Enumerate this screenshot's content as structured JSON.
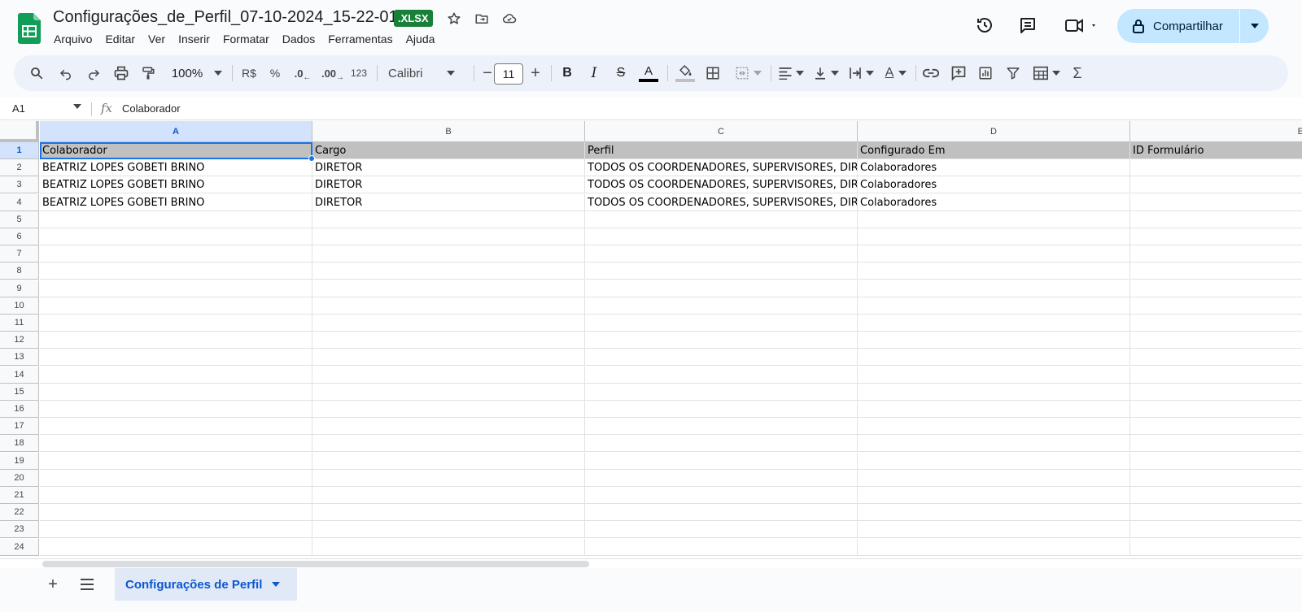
{
  "doc": {
    "title": "Configurações_de_Perfil_07-10-2024_15-22-01",
    "badge": ".XLSX"
  },
  "menu": [
    "Arquivo",
    "Editar",
    "Ver",
    "Inserir",
    "Formatar",
    "Dados",
    "Ferramentas",
    "Ajuda"
  ],
  "share": {
    "label": "Compartilhar"
  },
  "toolbar": {
    "zoom": "100%",
    "currency": "R$",
    "percent": "%",
    "decrease_decimal": ".0",
    "increase_decimal": ".00",
    "number_format": "123",
    "font": "Calibri",
    "font_size": "11"
  },
  "formula_bar": {
    "cell_ref": "A1",
    "value": "Colaborador"
  },
  "columns": [
    "A",
    "B",
    "C",
    "D",
    "E"
  ],
  "rows": [
    "1",
    "2",
    "3",
    "4",
    "5",
    "6",
    "7",
    "8",
    "9",
    "10",
    "11",
    "12",
    "13",
    "14",
    "15",
    "16",
    "17",
    "18",
    "19",
    "20",
    "21",
    "22",
    "23",
    "24"
  ],
  "table": {
    "headers": [
      "Colaborador",
      "Cargo",
      "Perfil",
      "Configurado Em",
      "ID Formulário"
    ],
    "data": [
      [
        "BEATRIZ LOPES GOBETI BRINO",
        "DIRETOR",
        "TODOS OS COORDENADORES, SUPERVISORES, DIRET",
        "Colaboradores",
        ""
      ],
      [
        "BEATRIZ LOPES GOBETI BRINO",
        "DIRETOR",
        "TODOS OS COORDENADORES, SUPERVISORES, DIRET",
        "Colaboradores",
        ""
      ],
      [
        "BEATRIZ LOPES GOBETI BRINO",
        "DIRETOR",
        "TODOS OS COORDENADORES, SUPERVISORES, DIRET",
        "Colaboradores",
        ""
      ]
    ]
  },
  "sheet_tab": {
    "label": "Configurações de Perfil"
  },
  "colors": {
    "accent": "#0b57d0",
    "badge": "#188038",
    "share_bg": "#c2e7ff",
    "header_fill": "#c0c0c0"
  }
}
